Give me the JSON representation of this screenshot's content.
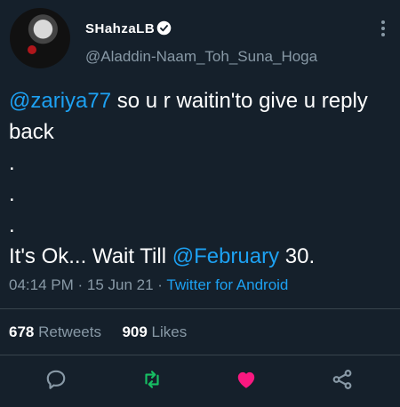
{
  "user": {
    "display_name": "SHahzaLB",
    "handle": "@Aladdin-Naam_Toh_Suna_Hoga",
    "verified": true,
    "verified_icon": "verified-badge-icon"
  },
  "tweet": {
    "line1_mention": "@zariya77",
    "line1_text": " so u r waitin'to give u reply back",
    "dot1": ".",
    "dot2": ".",
    "dot3": ".",
    "line_final_prefix": "It's Ok... Wait Till ",
    "line_final_mention": "@February",
    "line_final_suffix": " 30."
  },
  "meta": {
    "time": "04:14 PM",
    "separator": " · ",
    "date": "15 Jun 21",
    "source_sep": " · ",
    "source": "Twitter for Android"
  },
  "stats": {
    "retweets_count": "678",
    "retweets_label": " Retweets",
    "likes_count": "909",
    "likes_label": " Likes"
  },
  "actions": {
    "reply_icon": "reply-bubble-icon",
    "retweet_icon": "retweet-icon",
    "like_icon": "heart-icon",
    "share_icon": "share-icon"
  },
  "colors": {
    "background": "#15202b",
    "accent": "#1da1f2",
    "secondary_text": "#8899a6",
    "retweet_green": "#17bf63",
    "like_pink": "#f91880",
    "divider": "#38444d"
  }
}
